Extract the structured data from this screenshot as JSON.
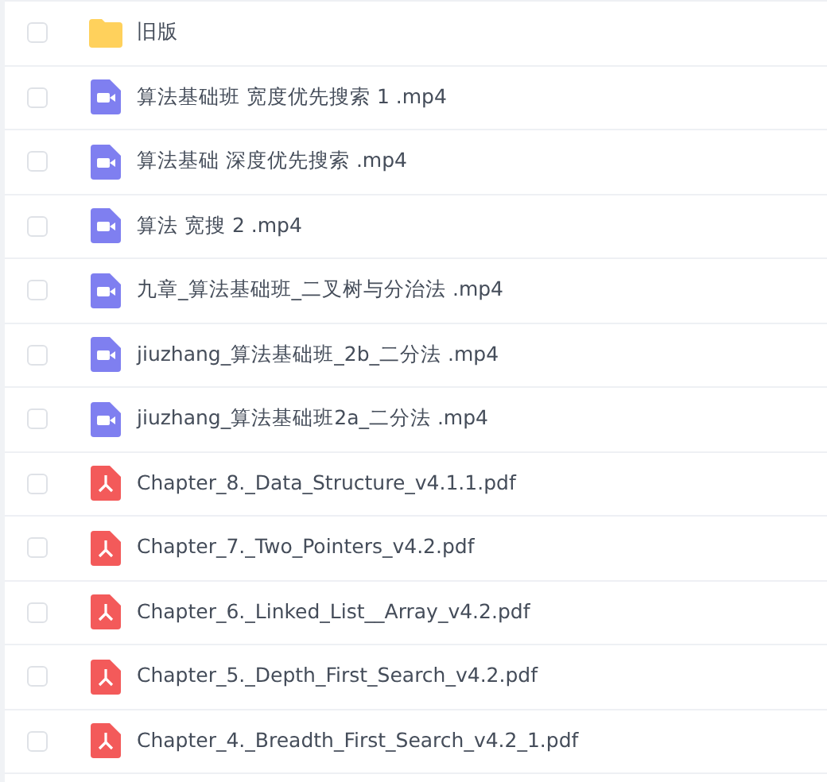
{
  "files": [
    {
      "kind": "folder",
      "name": "旧版",
      "checked": false
    },
    {
      "kind": "video",
      "name": "算法基础班 宽度优先搜索 1 .mp4",
      "checked": false
    },
    {
      "kind": "video",
      "name": "算法基础 深度优先搜索 .mp4",
      "checked": false
    },
    {
      "kind": "video",
      "name": "算法 宽搜 2 .mp4",
      "checked": false
    },
    {
      "kind": "video",
      "name": "九章_算法基础班_二叉树与分治法 .mp4",
      "checked": false
    },
    {
      "kind": "video",
      "name": "jiuzhang_算法基础班_2b_二分法 .mp4",
      "checked": false
    },
    {
      "kind": "video",
      "name": "jiuzhang_算法基础班2a_二分法 .mp4",
      "checked": false
    },
    {
      "kind": "pdf",
      "name": "Chapter_8._Data_Structure_v4.1.1.pdf",
      "checked": false
    },
    {
      "kind": "pdf",
      "name": "Chapter_7._Two_Pointers_v4.2.pdf",
      "checked": false
    },
    {
      "kind": "pdf",
      "name": "Chapter_6._Linked_List__Array_v4.2.pdf",
      "checked": false
    },
    {
      "kind": "pdf",
      "name": "Chapter_5._Depth_First_Search_v4.2.pdf",
      "checked": false
    },
    {
      "kind": "pdf",
      "name": "Chapter_4._Breadth_First_Search_v4.2_1.pdf",
      "checked": false
    }
  ]
}
